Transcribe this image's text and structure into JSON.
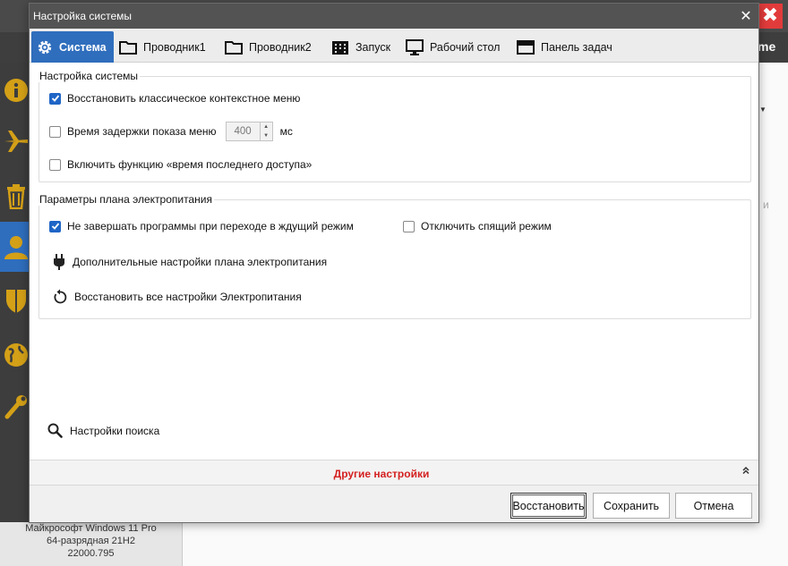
{
  "background_app": {
    "header_text": "me",
    "side_icons": [
      "info-icon",
      "plane-icon",
      "trash-icon",
      "user-icon",
      "shield-icon",
      "globe-icon",
      "wrench-icon"
    ],
    "status_lines": [
      "Майкрософт Windows 11 Pro",
      "64-разрядная 21H2",
      "22000.795"
    ],
    "faint_text": "и",
    "close_glyph": "✖"
  },
  "dialog": {
    "title": "Настройка системы",
    "close_glyph": "✕",
    "tabs": [
      {
        "label": "Система",
        "icon": "gear-icon",
        "active": true
      },
      {
        "label": "Проводник1",
        "icon": "folder-icon",
        "active": false
      },
      {
        "label": "Проводник2",
        "icon": "folder-icon",
        "active": false
      },
      {
        "label": "Запуск",
        "icon": "building-icon",
        "active": false
      },
      {
        "label": "Рабочий стол",
        "icon": "monitor-icon",
        "active": false
      },
      {
        "label": "Панель задач",
        "icon": "taskbar-icon",
        "active": false
      }
    ],
    "system_group": {
      "title": "Настройка системы",
      "restore_menu": {
        "label": "Восстановить классическое контекстное меню",
        "checked": true
      },
      "menu_delay": {
        "label": "Время задержки показа меню",
        "checked": false,
        "value": "400",
        "unit": "мс"
      },
      "last_access": {
        "label": "Включить функцию «время последнего доступа»",
        "checked": false
      }
    },
    "power_group": {
      "title": "Параметры плана электропитания",
      "no_close_programs": {
        "label": "Не завершать программы при переходе в ждущий режим",
        "checked": true
      },
      "disable_sleep": {
        "label": "Отключить спящий режим",
        "checked": false
      },
      "advanced_link": {
        "label": "Дополнительные настройки плана электропитания",
        "icon": "plug-icon"
      },
      "restore_link": {
        "label": "Восстановить все настройки Электропитания",
        "icon": "restore-icon"
      }
    },
    "search_link": {
      "label": "Настройки поиска",
      "icon": "search-icon"
    },
    "other_settings": {
      "label": "Другие настройки",
      "chevron": "⌃"
    },
    "buttons": {
      "restore": "Восстановить",
      "save": "Сохранить",
      "cancel": "Отмена"
    }
  },
  "colors": {
    "accent": "#2f6ebd",
    "checkbox": "#1f65c6",
    "other_settings": "#d42020",
    "side_icon": "#d4a017"
  }
}
